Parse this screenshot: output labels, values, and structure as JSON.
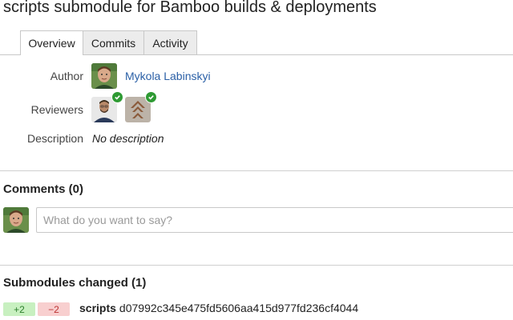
{
  "pull_request": {
    "title": "scripts submodule for Bamboo builds & deployments"
  },
  "tabs": [
    {
      "label": "Overview",
      "active": true
    },
    {
      "label": "Commits",
      "active": false
    },
    {
      "label": "Activity",
      "active": false
    }
  ],
  "overview": {
    "author_label": "Author",
    "author_name": "Mykola Labinskyi",
    "reviewers_label": "Reviewers",
    "reviewers": [
      {
        "avatar_icon": "reviewer-person-avatar",
        "approved": true
      },
      {
        "avatar_icon": "reviewer-logo-avatar",
        "approved": true
      }
    ],
    "description_label": "Description",
    "description_value": "No description"
  },
  "comments": {
    "heading": "Comments (0)",
    "input_placeholder": "What do you want to say?"
  },
  "submodules": {
    "heading": "Submodules changed (1)",
    "items": [
      {
        "additions": "+2",
        "deletions": "−2",
        "name": "scripts",
        "commit": "d07992c345e475fd5606aa415d977fd236cf4044"
      }
    ]
  },
  "colors": {
    "link": "#2a5fa6",
    "approved": "#2e9a33",
    "additions_bg": "#c8f0c0",
    "deletions_bg": "#f8cfcf"
  }
}
